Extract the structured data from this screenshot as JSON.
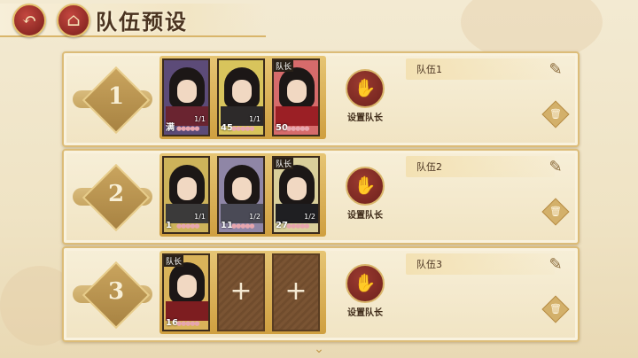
{
  "header": {
    "back_icon": "back-arrow-icon",
    "home_icon": "home-icon",
    "title": "队伍预设"
  },
  "teams": [
    {
      "number": "1",
      "name": "队伍1",
      "set_leader_label": "设置队长",
      "slots": [
        {
          "type": "character",
          "level": "满",
          "count": "1/1",
          "leader": false,
          "cloth": "#6a2430",
          "bg": "#5c4b78"
        },
        {
          "type": "character",
          "level": "45",
          "count": "1/1",
          "leader": false,
          "cloth": "#2d2a2a",
          "bg": "#d8c45c"
        },
        {
          "type": "character",
          "level": "50",
          "count": "",
          "leader": true,
          "leader_label": "队长",
          "cloth": "#9b1f25",
          "bg": "#d66b6b"
        }
      ]
    },
    {
      "number": "2",
      "name": "队伍2",
      "set_leader_label": "设置队长",
      "slots": [
        {
          "type": "character",
          "level": "1",
          "count": "1/1",
          "leader": false,
          "cloth": "#3b3a3a",
          "bg": "#cdb35a"
        },
        {
          "type": "character",
          "level": "11",
          "count": "1/2",
          "leader": false,
          "cloth": "#4a4a56",
          "bg": "#8f86a6"
        },
        {
          "type": "character",
          "level": "27",
          "count": "1/2",
          "leader": true,
          "leader_label": "队长",
          "cloth": "#1f1f22",
          "bg": "#d9cf9a"
        }
      ]
    },
    {
      "number": "3",
      "name": "队伍3",
      "set_leader_label": "设置队长",
      "slots": [
        {
          "type": "character",
          "level": "16",
          "count": "",
          "leader": true,
          "leader_label": "队长",
          "cloth": "#7d1d20",
          "bg": "#d9b35a"
        },
        {
          "type": "empty",
          "symbol": "+"
        },
        {
          "type": "empty",
          "symbol": "+"
        }
      ]
    }
  ],
  "icons": {
    "edit": "pencil-icon",
    "delete": "trash-icon",
    "set_leader": "crown-fan-icon",
    "scroll": "chevron-down-icon"
  },
  "colors": {
    "accent_gold": "#d9b56a",
    "button_red": "#8e2a25",
    "panel_bg": "#f4e8cb"
  }
}
